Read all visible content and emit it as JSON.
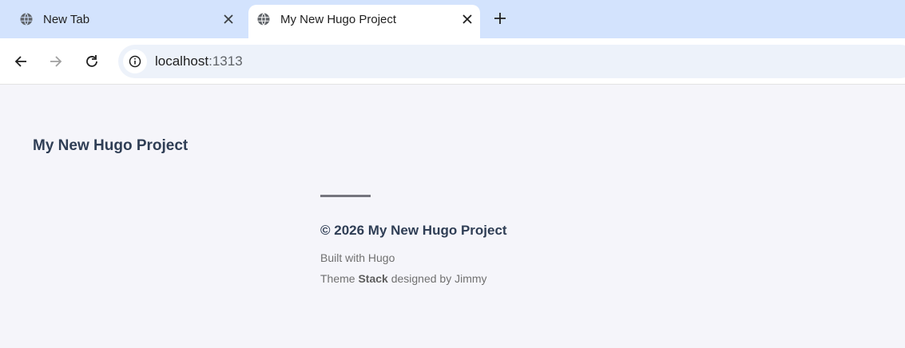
{
  "tabs": [
    {
      "title": "New Tab",
      "icon": "globe-icon"
    },
    {
      "title": "My New Hugo Project",
      "icon": "globe-icon"
    }
  ],
  "address": {
    "host": "localhost",
    "port": ":1313"
  },
  "page": {
    "site_name": "My New Hugo Project",
    "copyright": "© 2026 My New Hugo Project",
    "powered_by": "Built with Hugo",
    "theme_prefix": "Theme ",
    "theme_name": "Stack",
    "theme_suffix": " designed by Jimmy"
  }
}
